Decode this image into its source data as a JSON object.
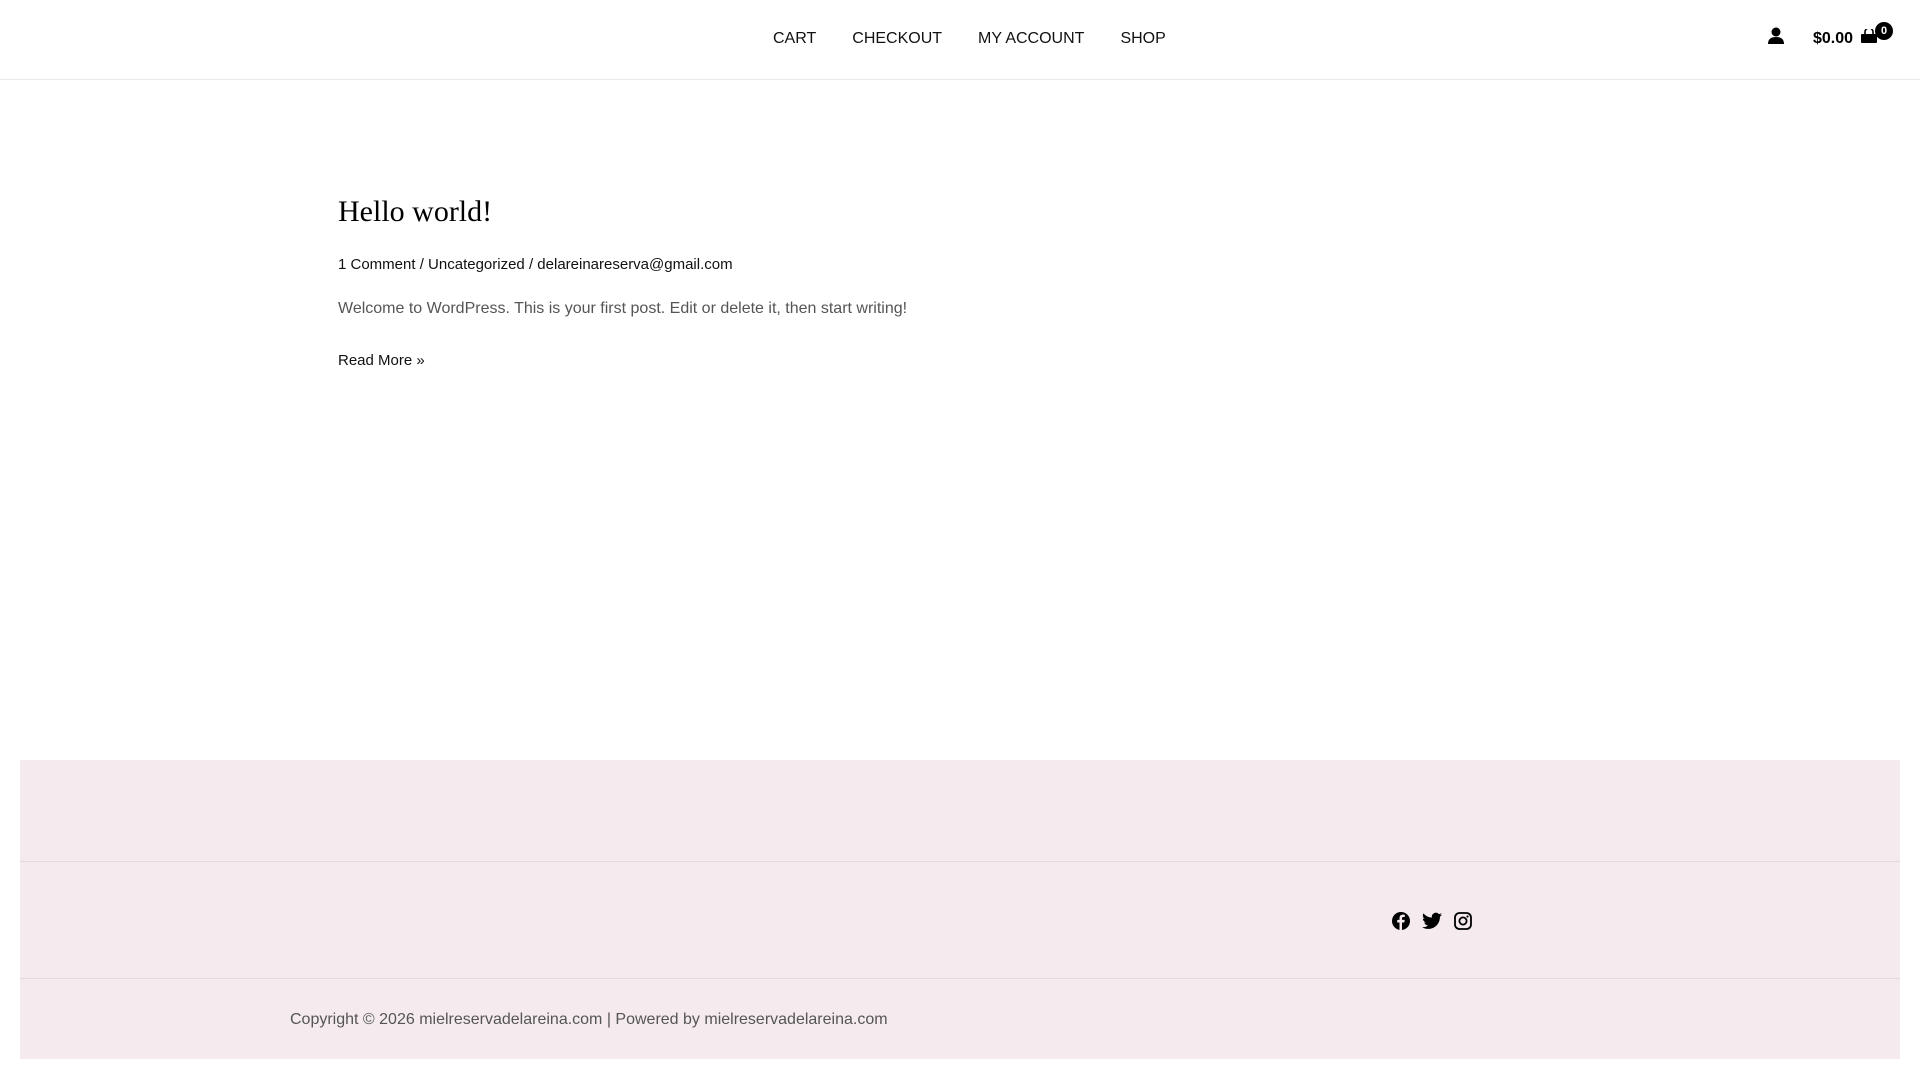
{
  "nav": {
    "items": [
      "CART",
      "CHECKOUT",
      "MY ACCOUNT",
      "SHOP"
    ]
  },
  "cart": {
    "total": "$0.00",
    "count": "0"
  },
  "post": {
    "title": "Hello world!",
    "comments": "1 Comment",
    "category": "Uncategorized",
    "author": "delareinareserva@gmail.com",
    "sep": "/",
    "excerpt": "Welcome to WordPress. This is your first post. Edit or delete it, then start writing!",
    "read_more": "Read More »"
  },
  "footer": {
    "copyright": "Copyright © 2026 mielreservadelareina.com | Powered by mielreservadelareina.com"
  },
  "colors": {
    "footer_bg": "#f5ebef"
  }
}
